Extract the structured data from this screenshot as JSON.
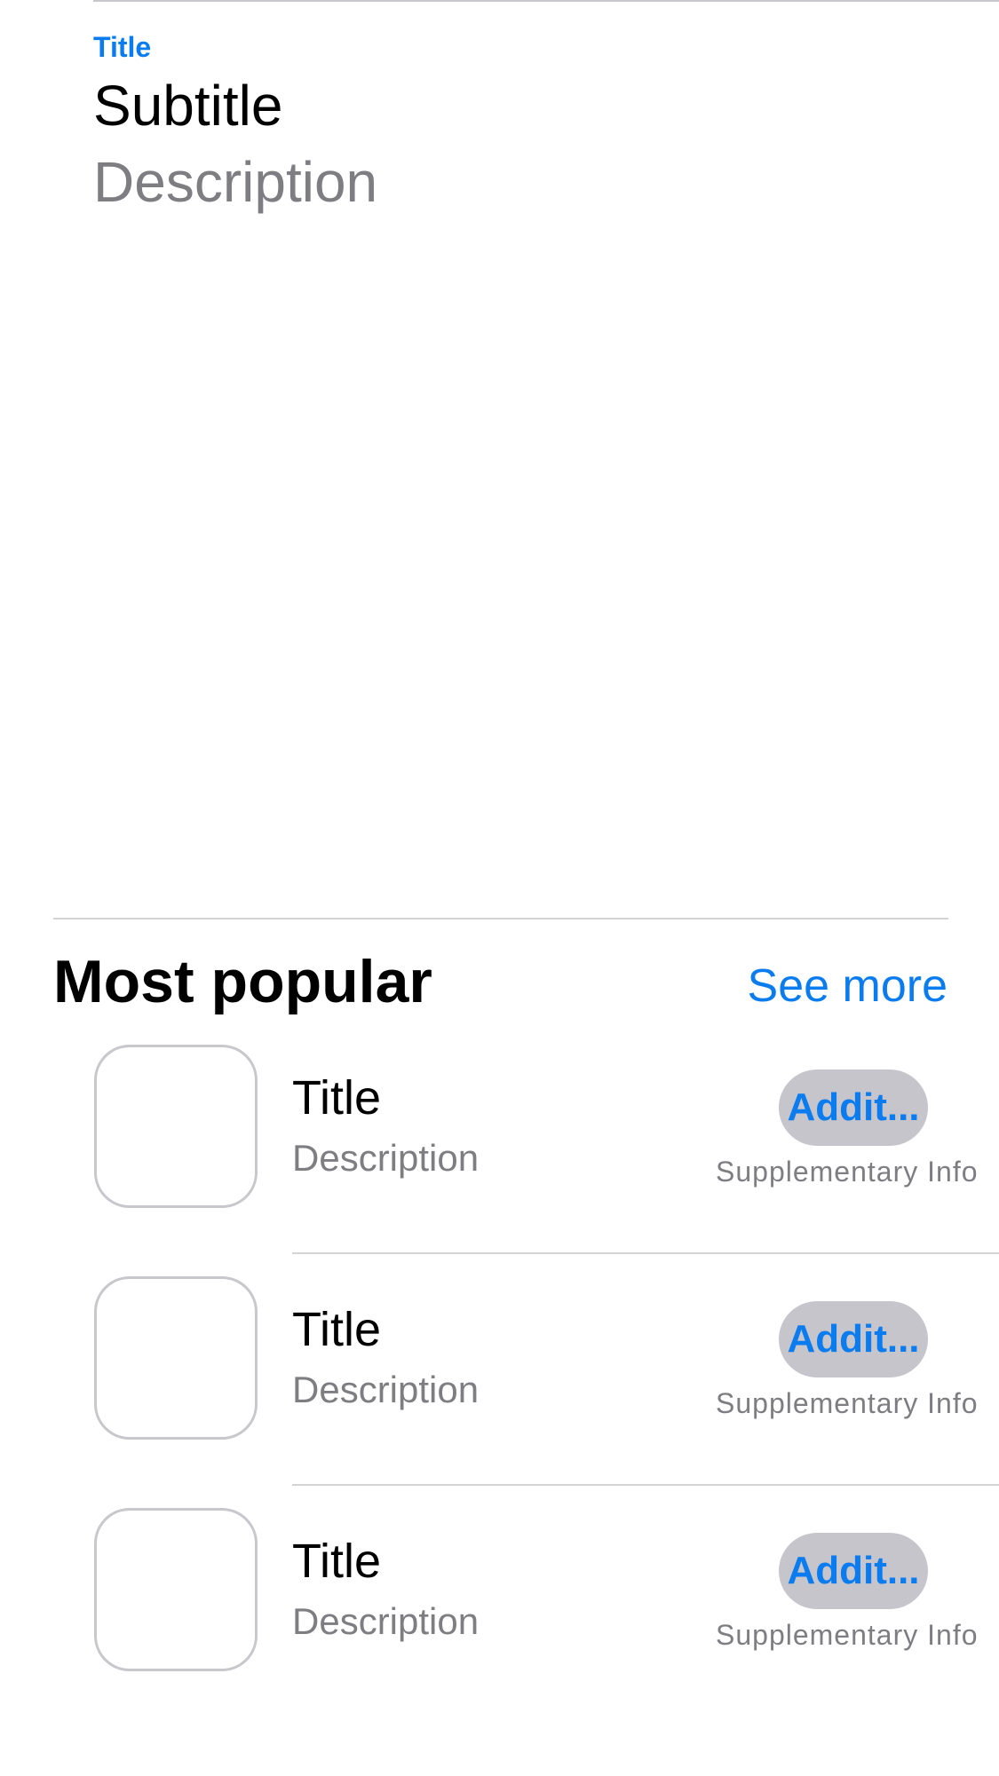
{
  "featured": {
    "title": "Title",
    "subtitle": "Subtitle",
    "description": "Description"
  },
  "section": {
    "heading": "Most popular",
    "see_more": "See more"
  },
  "list": [
    {
      "title": "Title",
      "description": "Description",
      "action_label": "Addit...",
      "supplementary": "Supplementary Info"
    },
    {
      "title": "Title",
      "description": "Description",
      "action_label": "Addit...",
      "supplementary": "Supplementary Info"
    },
    {
      "title": "Title",
      "description": "Description",
      "action_label": "Addit...",
      "supplementary": "Supplementary Info"
    }
  ],
  "colors": {
    "accent": "#0a7cf0",
    "secondary_text": "#7e7e82",
    "pill_background": "#c5c5cb",
    "separator": "#d3d3d6"
  }
}
